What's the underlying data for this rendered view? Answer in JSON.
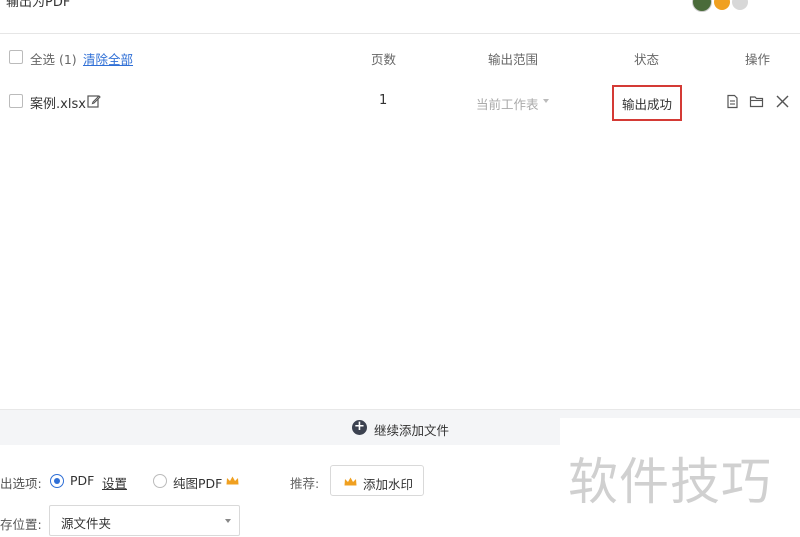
{
  "window": {
    "title": "输出为PDF"
  },
  "header": {
    "select_all": "全选 (1)",
    "clear_all": "清除全部",
    "col_pages": "页数",
    "col_range": "输出范围",
    "col_status": "状态",
    "col_action": "操作"
  },
  "files": [
    {
      "name": "案例.xlsx",
      "pages": "1",
      "range": "当前工作表",
      "status": "输出成功"
    }
  ],
  "add_bar": {
    "label": "继续添加文件"
  },
  "options": {
    "output_label": "出选项:",
    "pdf_label": "PDF",
    "settings_label": "设置",
    "image_pdf_label": "纯图PDF",
    "recommend_label": "推荐:",
    "watermark_button": "添加水印",
    "save_label": "存位置:",
    "save_value": "源文件夹"
  },
  "overlay": {
    "watermark_text": "软件技巧"
  },
  "colors": {
    "accent": "#2f6fd6",
    "highlight_box": "#d43a35",
    "crown": "#f0a020"
  }
}
